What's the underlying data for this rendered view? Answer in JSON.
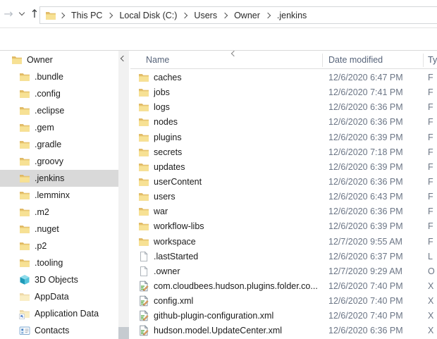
{
  "toolbar": {
    "breadcrumb": [
      "This PC",
      "Local Disk (C:)",
      "Users",
      "Owner",
      ".jenkins"
    ]
  },
  "sidebar": {
    "items": [
      {
        "label": "Owner",
        "icon": "folder",
        "indent": 0,
        "selected": false
      },
      {
        "label": ".bundle",
        "icon": "folder",
        "indent": 1,
        "selected": false
      },
      {
        "label": ".config",
        "icon": "folder",
        "indent": 1,
        "selected": false
      },
      {
        "label": ".eclipse",
        "icon": "folder",
        "indent": 1,
        "selected": false
      },
      {
        "label": ".gem",
        "icon": "folder",
        "indent": 1,
        "selected": false
      },
      {
        "label": ".gradle",
        "icon": "folder",
        "indent": 1,
        "selected": false
      },
      {
        "label": ".groovy",
        "icon": "folder",
        "indent": 1,
        "selected": false
      },
      {
        "label": ".jenkins",
        "icon": "folder",
        "indent": 1,
        "selected": true
      },
      {
        "label": ".lemminx",
        "icon": "folder",
        "indent": 1,
        "selected": false
      },
      {
        "label": ".m2",
        "icon": "folder",
        "indent": 1,
        "selected": false
      },
      {
        "label": ".nuget",
        "icon": "folder",
        "indent": 1,
        "selected": false
      },
      {
        "label": ".p2",
        "icon": "folder",
        "indent": 1,
        "selected": false
      },
      {
        "label": ".tooling",
        "icon": "folder",
        "indent": 1,
        "selected": false
      },
      {
        "label": "3D Objects",
        "icon": "cube",
        "indent": 1,
        "selected": false
      },
      {
        "label": "AppData",
        "icon": "folder-faded",
        "indent": 1,
        "selected": false
      },
      {
        "label": "Application Data",
        "icon": "folder-shortcut",
        "indent": 1,
        "selected": false
      },
      {
        "label": "Contacts",
        "icon": "contacts",
        "indent": 1,
        "selected": false
      }
    ]
  },
  "filelist": {
    "columns": {
      "name": "Name",
      "date": "Date modified",
      "type": "Ty"
    },
    "rows": [
      {
        "name": "caches",
        "icon": "folder",
        "date": "12/6/2020 6:47 PM",
        "type": "F"
      },
      {
        "name": "jobs",
        "icon": "folder",
        "date": "12/6/2020 7:41 PM",
        "type": "F"
      },
      {
        "name": "logs",
        "icon": "folder",
        "date": "12/6/2020 6:36 PM",
        "type": "F"
      },
      {
        "name": "nodes",
        "icon": "folder",
        "date": "12/6/2020 6:36 PM",
        "type": "F"
      },
      {
        "name": "plugins",
        "icon": "folder",
        "date": "12/6/2020 6:39 PM",
        "type": "F"
      },
      {
        "name": "secrets",
        "icon": "folder",
        "date": "12/6/2020 7:18 PM",
        "type": "F"
      },
      {
        "name": "updates",
        "icon": "folder",
        "date": "12/6/2020 6:39 PM",
        "type": "F"
      },
      {
        "name": "userContent",
        "icon": "folder",
        "date": "12/6/2020 6:36 PM",
        "type": "F"
      },
      {
        "name": "users",
        "icon": "folder",
        "date": "12/6/2020 6:43 PM",
        "type": "F"
      },
      {
        "name": "war",
        "icon": "folder",
        "date": "12/6/2020 6:36 PM",
        "type": "F"
      },
      {
        "name": "workflow-libs",
        "icon": "folder",
        "date": "12/6/2020 6:39 PM",
        "type": "F"
      },
      {
        "name": "workspace",
        "icon": "folder",
        "date": "12/7/2020 9:55 AM",
        "type": "F"
      },
      {
        "name": ".lastStarted",
        "icon": "file",
        "date": "12/6/2020 6:37 PM",
        "type": "L"
      },
      {
        "name": ".owner",
        "icon": "file",
        "date": "12/7/2020 9:29 AM",
        "type": "O"
      },
      {
        "name": "com.cloudbees.hudson.plugins.folder.co...",
        "icon": "xml",
        "date": "12/6/2020 7:40 PM",
        "type": "X"
      },
      {
        "name": "config.xml",
        "icon": "xml",
        "date": "12/6/2020 7:40 PM",
        "type": "X"
      },
      {
        "name": "github-plugin-configuration.xml",
        "icon": "xml",
        "date": "12/6/2020 7:40 PM",
        "type": "X"
      },
      {
        "name": "hudson.model.UpdateCenter.xml",
        "icon": "xml",
        "date": "12/6/2020 6:36 PM",
        "type": "X"
      }
    ]
  },
  "colors": {
    "selection_inactive": "#d9d9d9",
    "folder_yellow": "#f6e092",
    "header_text": "#57647a",
    "secondary_text": "#6b7585"
  }
}
